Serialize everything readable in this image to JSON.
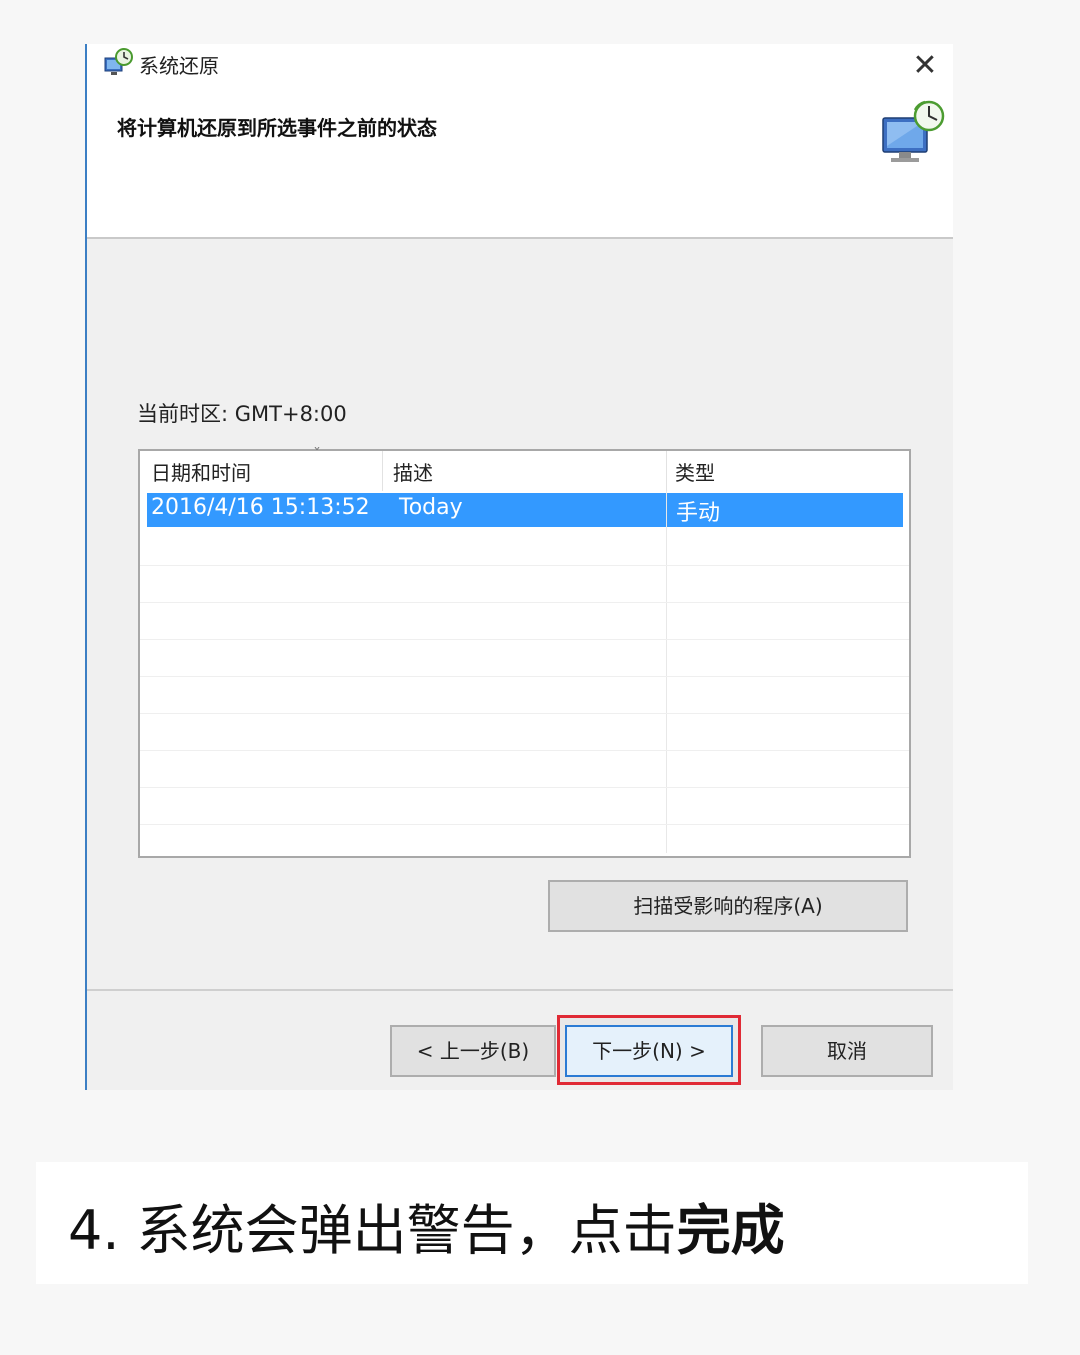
{
  "window": {
    "title": "系统还原",
    "close_symbol": "✕",
    "subtitle": "将计算机还原到所选事件之前的状态",
    "title_icon": "system-restore-icon",
    "header_illustration": "computer-restore-icon"
  },
  "timezone_label": "当前时区: GMT+8:00",
  "restore_points": {
    "columns": [
      "日期和时间",
      "描述",
      "类型"
    ],
    "sort_indicator": "ˇ",
    "rows": [
      {
        "date_time": "2016/4/16 15:13:52",
        "description": "Today",
        "type": "手动",
        "selected": true
      }
    ]
  },
  "buttons": {
    "scan": "扫描受影响的程序(A)",
    "back": "< 上一步(B)",
    "next": "下一步(N) >",
    "cancel": "取消"
  },
  "colors": {
    "selection": "#3399ff",
    "highlight_box": "#e02a35",
    "focus_border": "#2b7bd4"
  },
  "caption": {
    "prefix": "4. 系统会弹出警告，点击",
    "emphasis": "完成"
  }
}
